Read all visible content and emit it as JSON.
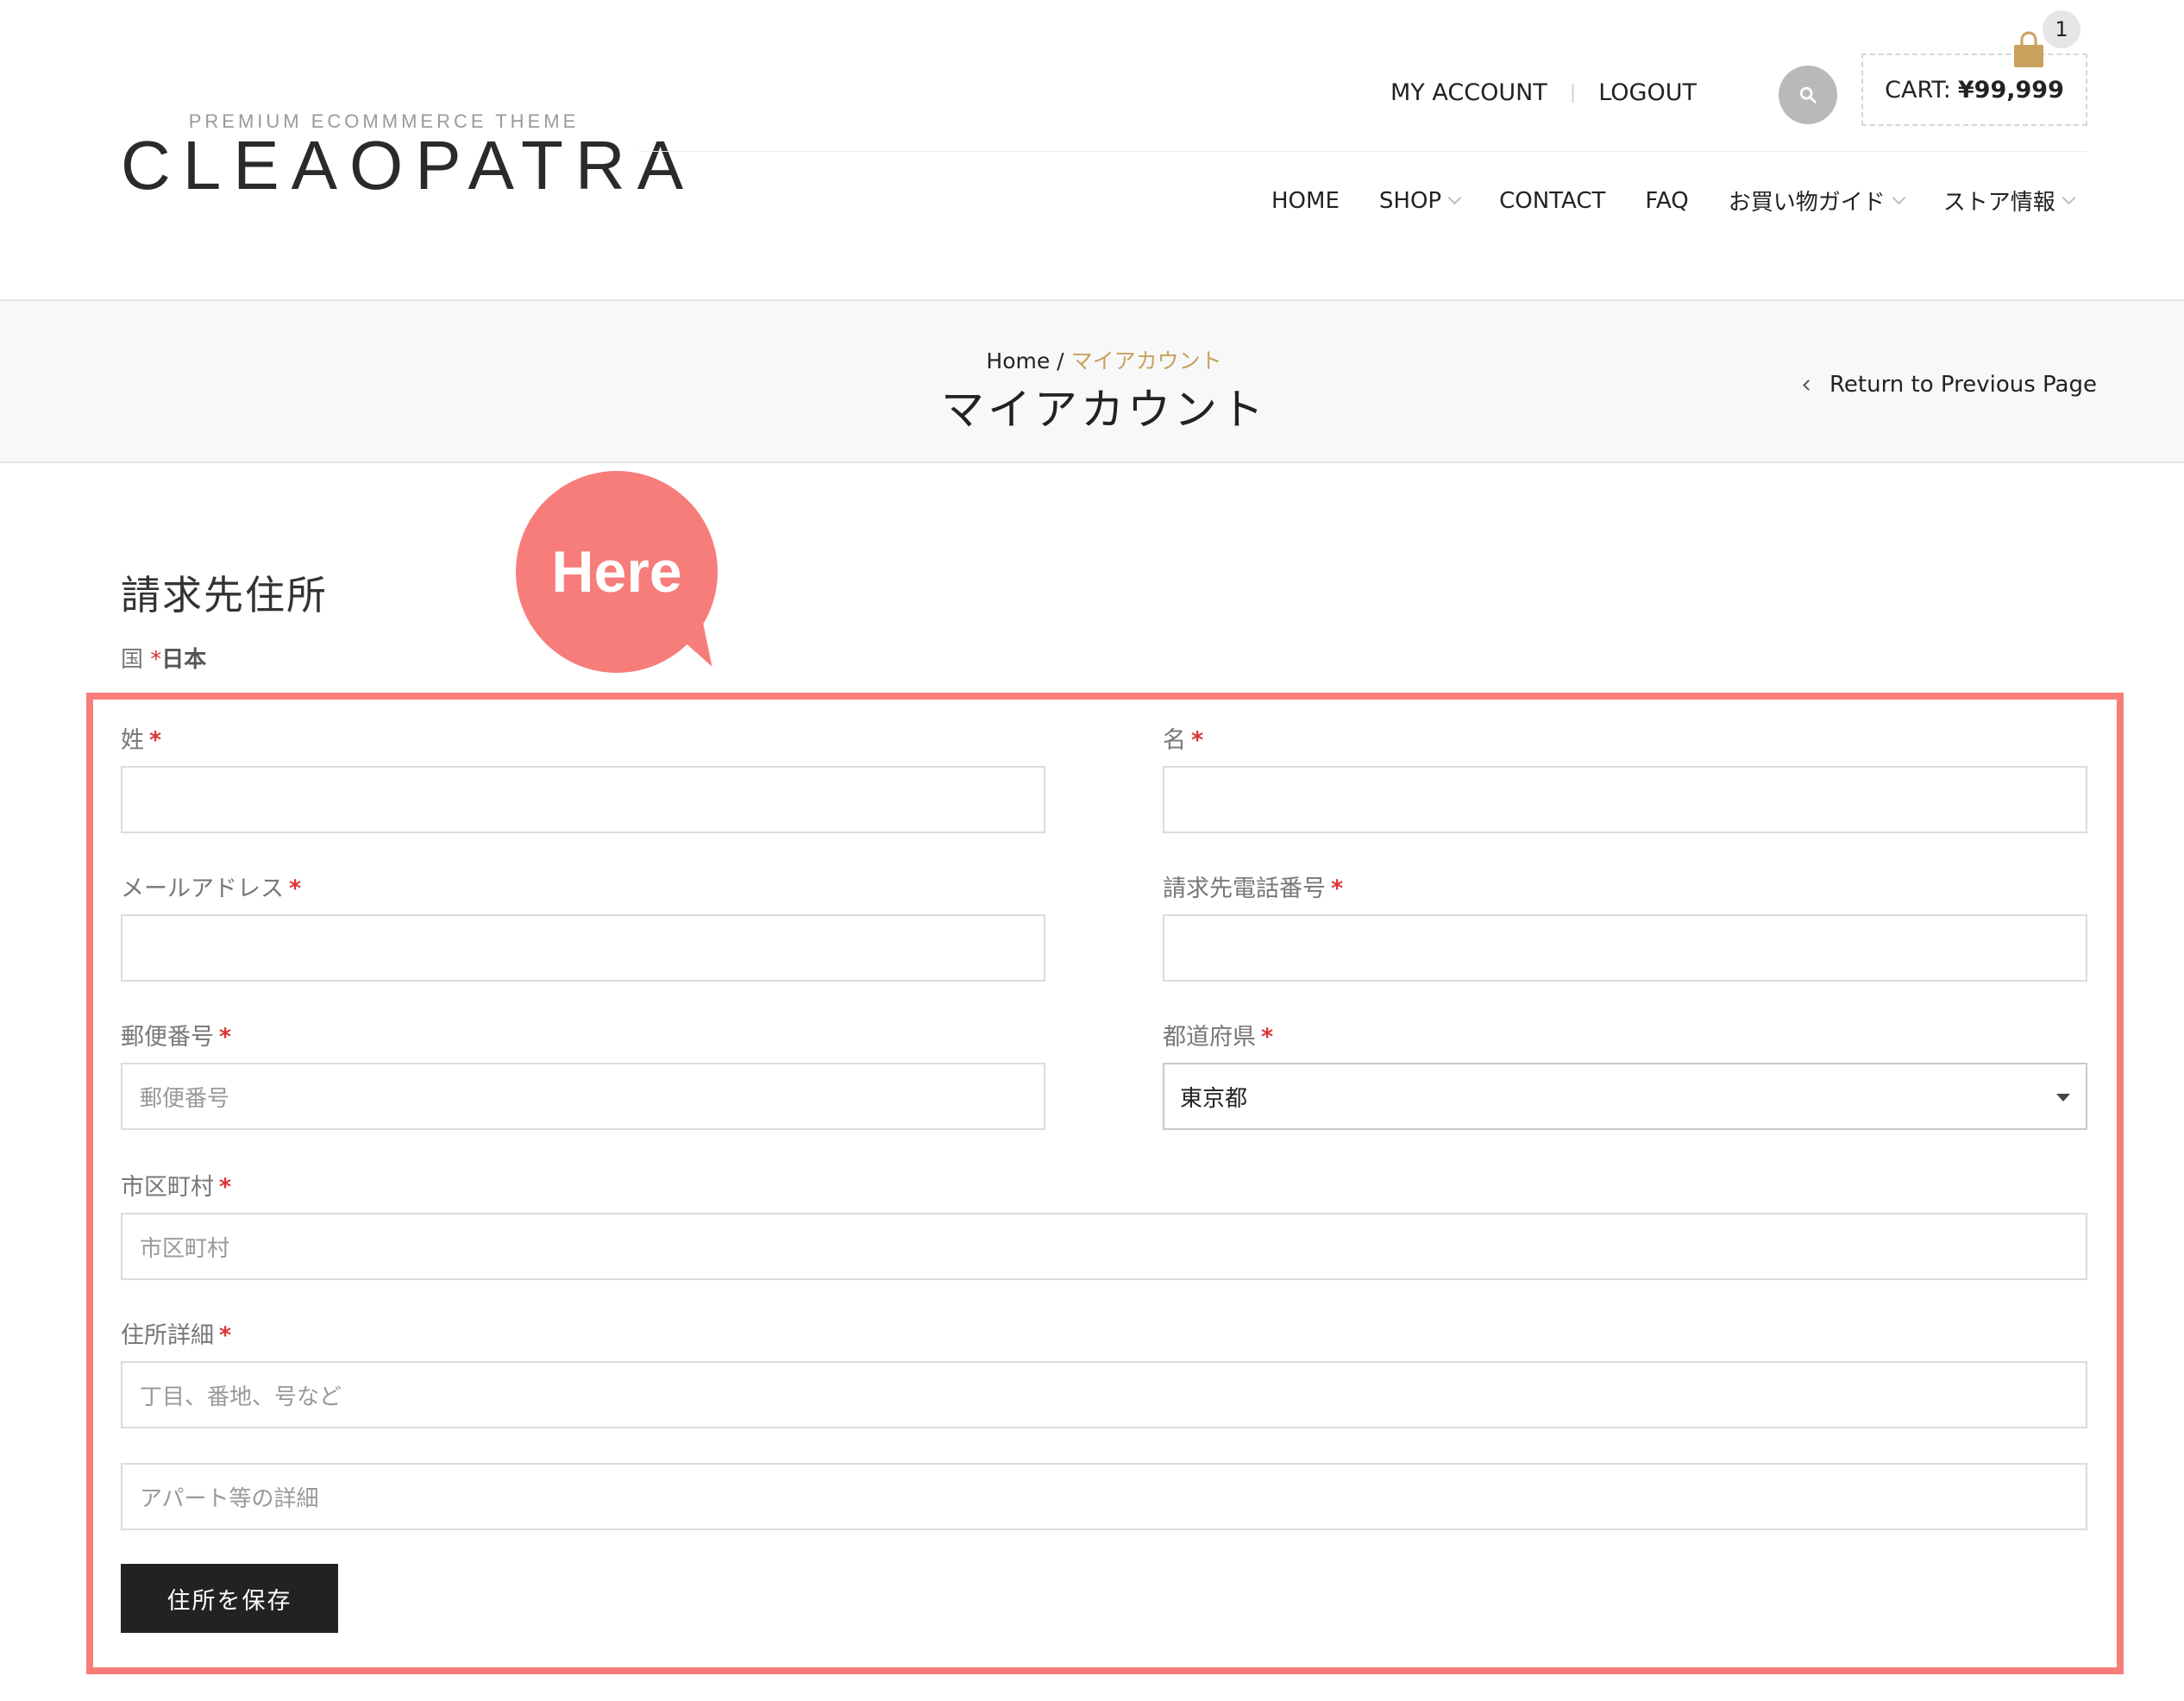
{
  "logo": {
    "tagline": "PREMIUM ECOMMMERCE THEME",
    "wordmark": "CLEAOPATRA"
  },
  "top_links": {
    "account": "MY ACCOUNT",
    "separator": "|",
    "logout": "LOGOUT"
  },
  "cart": {
    "label": "CART:",
    "total": "¥99,999",
    "count": "1",
    "icon": "shopping-bag-icon",
    "icon_color": "#c9a25e"
  },
  "search": {
    "icon": "search-icon"
  },
  "nav": {
    "items": [
      {
        "label": "HOME",
        "has_dropdown": false
      },
      {
        "label": "SHOP",
        "has_dropdown": true
      },
      {
        "label": "CONTACT",
        "has_dropdown": false
      },
      {
        "label": "FAQ",
        "has_dropdown": false
      },
      {
        "label": "お買い物ガイド",
        "has_dropdown": true
      },
      {
        "label": "ストア情報",
        "has_dropdown": true
      }
    ]
  },
  "breadcrumb": {
    "home": "Home",
    "separator": " / ",
    "current": "マイアカウント"
  },
  "page_title": "マイアカウント",
  "return_link": "Return to Previous Page",
  "annotation": {
    "text": "Here",
    "color": "#f77d7a"
  },
  "form": {
    "heading": "請求先住所",
    "country": {
      "label": "国",
      "required_mark": "*",
      "value": "日本"
    },
    "required_mark": "*",
    "fields": {
      "last_name": {
        "label": "姓",
        "value": "",
        "placeholder": ""
      },
      "first_name": {
        "label": "名",
        "value": "",
        "placeholder": ""
      },
      "email": {
        "label": "メールアドレス",
        "value": "",
        "placeholder": ""
      },
      "phone": {
        "label": "請求先電話番号",
        "value": "",
        "placeholder": ""
      },
      "postcode": {
        "label": "郵便番号",
        "value": "",
        "placeholder": "郵便番号"
      },
      "prefecture": {
        "label": "都道府県",
        "value": "東京都"
      },
      "city": {
        "label": "市区町村",
        "value": "",
        "placeholder": "市区町村"
      },
      "address1": {
        "label": "住所詳細",
        "value": "",
        "placeholder": "丁目、番地、号など"
      },
      "address2": {
        "value": "",
        "placeholder": "アパート等の詳細"
      }
    },
    "submit_label": "住所を保存"
  }
}
